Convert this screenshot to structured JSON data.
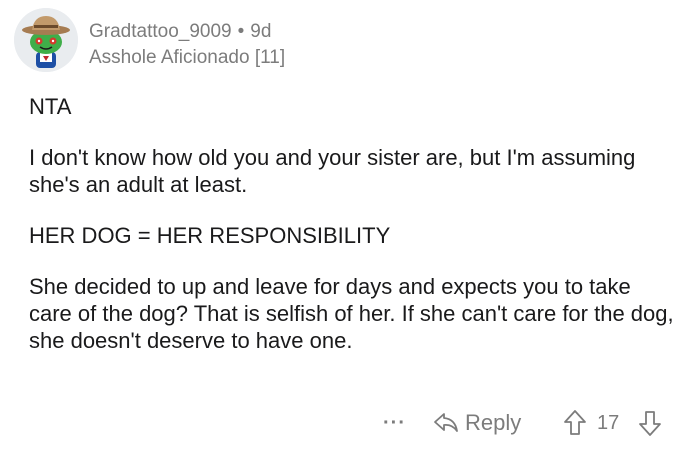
{
  "comment": {
    "author": "Gradtattoo_9009",
    "separator": "•",
    "age": "9d",
    "flair": "Asshole Aficionado [11]",
    "paragraphs": [
      "NTA",
      "I don't know how old you and your sister are, but I'm assuming she's an adult at least.",
      "HER DOG = HER RESPONSIBILITY",
      "She decided to up and leave for days and expects you to take care of the dog? That is selfish of her. If she can't care for the dog, she doesn't deserve to have one."
    ]
  },
  "actions": {
    "more_label": "···",
    "reply_label": "Reply",
    "score": "17"
  },
  "icons": {
    "avatar": "snoo-avatar-icon",
    "reply": "reply-arrow-icon",
    "upvote": "upvote-arrow-icon",
    "downvote": "downvote-arrow-icon"
  },
  "colors": {
    "text": "#1a1a1b",
    "meta": "#7c7c7c"
  }
}
